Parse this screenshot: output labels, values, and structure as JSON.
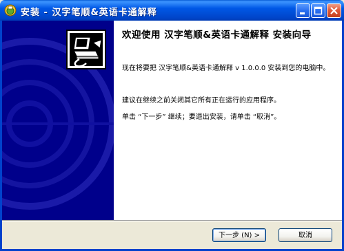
{
  "window": {
    "title": "安装 - 汉字笔顺&英语卡通解释",
    "colors": {
      "titlebar": "#0058e6",
      "banner": "#00008b",
      "frame": "#0042cc",
      "close": "#e05a3a"
    }
  },
  "content": {
    "heading": "欢迎使用 汉字笔顺&英语卡通解释 安装向导",
    "paragraph1": "现在将要把 汉字笔顺&英语卡通解释 v 1.0.0.0 安装到您的电脑中。",
    "paragraph2": "建议在继续之前关闭其它所有正在运行的应用程序。",
    "paragraph3": "单击 “下一步” 继续；要退出安装，请单击 “取消”。"
  },
  "buttons": {
    "next": "下一步 (N) >",
    "cancel": "取消"
  },
  "icons": {
    "app": "installer-app-icon",
    "logo": "computer-install-icon",
    "minimize": "minimize-icon",
    "maximize": "maximize-icon",
    "close": "close-icon"
  }
}
